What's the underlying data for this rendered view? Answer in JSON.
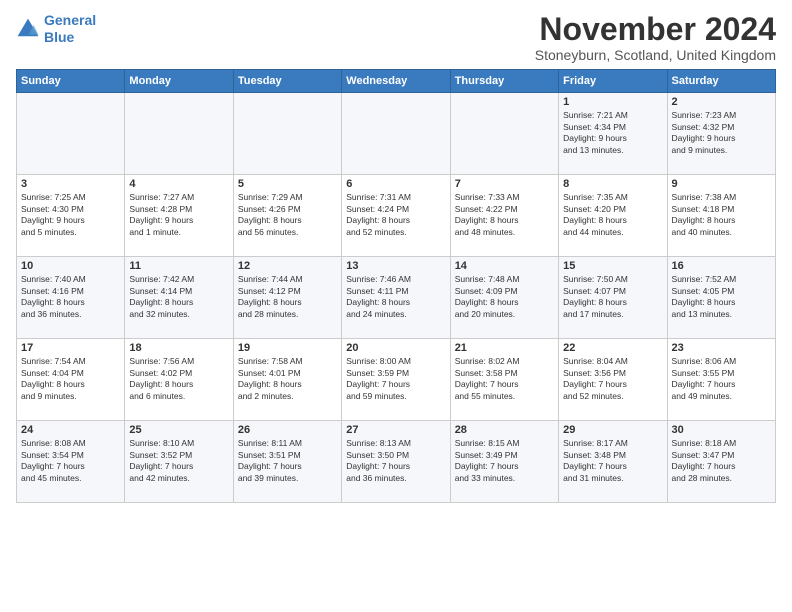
{
  "logo": {
    "line1": "General",
    "line2": "Blue"
  },
  "title": "November 2024",
  "location": "Stoneyburn, Scotland, United Kingdom",
  "weekdays": [
    "Sunday",
    "Monday",
    "Tuesday",
    "Wednesday",
    "Thursday",
    "Friday",
    "Saturday"
  ],
  "weeks": [
    [
      {
        "day": "",
        "detail": ""
      },
      {
        "day": "",
        "detail": ""
      },
      {
        "day": "",
        "detail": ""
      },
      {
        "day": "",
        "detail": ""
      },
      {
        "day": "",
        "detail": ""
      },
      {
        "day": "1",
        "detail": "Sunrise: 7:21 AM\nSunset: 4:34 PM\nDaylight: 9 hours\nand 13 minutes."
      },
      {
        "day": "2",
        "detail": "Sunrise: 7:23 AM\nSunset: 4:32 PM\nDaylight: 9 hours\nand 9 minutes."
      }
    ],
    [
      {
        "day": "3",
        "detail": "Sunrise: 7:25 AM\nSunset: 4:30 PM\nDaylight: 9 hours\nand 5 minutes."
      },
      {
        "day": "4",
        "detail": "Sunrise: 7:27 AM\nSunset: 4:28 PM\nDaylight: 9 hours\nand 1 minute."
      },
      {
        "day": "5",
        "detail": "Sunrise: 7:29 AM\nSunset: 4:26 PM\nDaylight: 8 hours\nand 56 minutes."
      },
      {
        "day": "6",
        "detail": "Sunrise: 7:31 AM\nSunset: 4:24 PM\nDaylight: 8 hours\nand 52 minutes."
      },
      {
        "day": "7",
        "detail": "Sunrise: 7:33 AM\nSunset: 4:22 PM\nDaylight: 8 hours\nand 48 minutes."
      },
      {
        "day": "8",
        "detail": "Sunrise: 7:35 AM\nSunset: 4:20 PM\nDaylight: 8 hours\nand 44 minutes."
      },
      {
        "day": "9",
        "detail": "Sunrise: 7:38 AM\nSunset: 4:18 PM\nDaylight: 8 hours\nand 40 minutes."
      }
    ],
    [
      {
        "day": "10",
        "detail": "Sunrise: 7:40 AM\nSunset: 4:16 PM\nDaylight: 8 hours\nand 36 minutes."
      },
      {
        "day": "11",
        "detail": "Sunrise: 7:42 AM\nSunset: 4:14 PM\nDaylight: 8 hours\nand 32 minutes."
      },
      {
        "day": "12",
        "detail": "Sunrise: 7:44 AM\nSunset: 4:12 PM\nDaylight: 8 hours\nand 28 minutes."
      },
      {
        "day": "13",
        "detail": "Sunrise: 7:46 AM\nSunset: 4:11 PM\nDaylight: 8 hours\nand 24 minutes."
      },
      {
        "day": "14",
        "detail": "Sunrise: 7:48 AM\nSunset: 4:09 PM\nDaylight: 8 hours\nand 20 minutes."
      },
      {
        "day": "15",
        "detail": "Sunrise: 7:50 AM\nSunset: 4:07 PM\nDaylight: 8 hours\nand 17 minutes."
      },
      {
        "day": "16",
        "detail": "Sunrise: 7:52 AM\nSunset: 4:05 PM\nDaylight: 8 hours\nand 13 minutes."
      }
    ],
    [
      {
        "day": "17",
        "detail": "Sunrise: 7:54 AM\nSunset: 4:04 PM\nDaylight: 8 hours\nand 9 minutes."
      },
      {
        "day": "18",
        "detail": "Sunrise: 7:56 AM\nSunset: 4:02 PM\nDaylight: 8 hours\nand 6 minutes."
      },
      {
        "day": "19",
        "detail": "Sunrise: 7:58 AM\nSunset: 4:01 PM\nDaylight: 8 hours\nand 2 minutes."
      },
      {
        "day": "20",
        "detail": "Sunrise: 8:00 AM\nSunset: 3:59 PM\nDaylight: 7 hours\nand 59 minutes."
      },
      {
        "day": "21",
        "detail": "Sunrise: 8:02 AM\nSunset: 3:58 PM\nDaylight: 7 hours\nand 55 minutes."
      },
      {
        "day": "22",
        "detail": "Sunrise: 8:04 AM\nSunset: 3:56 PM\nDaylight: 7 hours\nand 52 minutes."
      },
      {
        "day": "23",
        "detail": "Sunrise: 8:06 AM\nSunset: 3:55 PM\nDaylight: 7 hours\nand 49 minutes."
      }
    ],
    [
      {
        "day": "24",
        "detail": "Sunrise: 8:08 AM\nSunset: 3:54 PM\nDaylight: 7 hours\nand 45 minutes."
      },
      {
        "day": "25",
        "detail": "Sunrise: 8:10 AM\nSunset: 3:52 PM\nDaylight: 7 hours\nand 42 minutes."
      },
      {
        "day": "26",
        "detail": "Sunrise: 8:11 AM\nSunset: 3:51 PM\nDaylight: 7 hours\nand 39 minutes."
      },
      {
        "day": "27",
        "detail": "Sunrise: 8:13 AM\nSunset: 3:50 PM\nDaylight: 7 hours\nand 36 minutes."
      },
      {
        "day": "28",
        "detail": "Sunrise: 8:15 AM\nSunset: 3:49 PM\nDaylight: 7 hours\nand 33 minutes."
      },
      {
        "day": "29",
        "detail": "Sunrise: 8:17 AM\nSunset: 3:48 PM\nDaylight: 7 hours\nand 31 minutes."
      },
      {
        "day": "30",
        "detail": "Sunrise: 8:18 AM\nSunset: 3:47 PM\nDaylight: 7 hours\nand 28 minutes."
      }
    ]
  ]
}
